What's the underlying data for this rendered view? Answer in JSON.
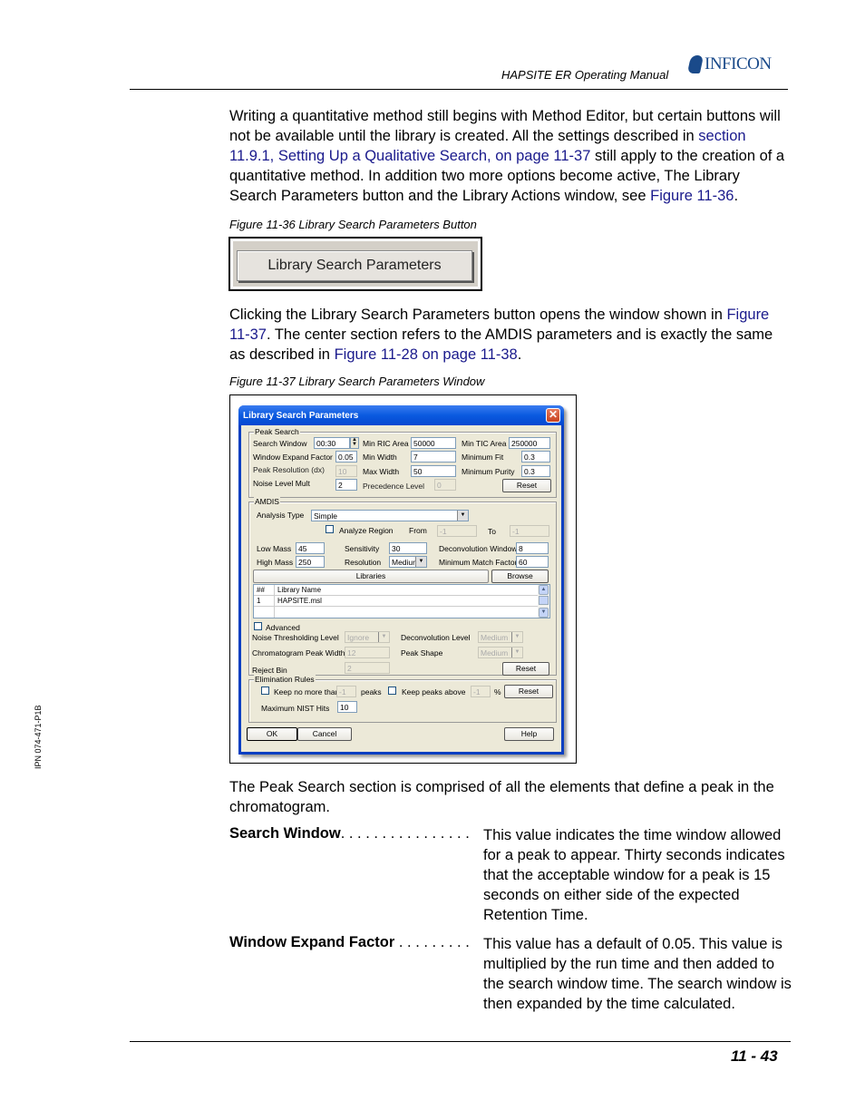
{
  "header": {
    "manual_title": "HAPSITE ER Operating Manual",
    "logo_text": "INFICON"
  },
  "side_code": "IPN 074-471-P1B",
  "intro": {
    "text_1": "Writing a quantitative method still begins with Method Editor, but certain buttons will not be available until the library is created. All the settings described in ",
    "link_1": "section 11.9.1, Setting Up a Qualitative Search, on page 11-37",
    "text_2": " still apply to the creation of a quantitative method. In addition two more options become active, The Library Search Parameters button and the Library Actions window, see ",
    "link_2": "Figure 11-36",
    "text_3": "."
  },
  "figure_36": {
    "caption": "Figure 11-36  Library Search Parameters Button",
    "button_label": "Library Search Parameters"
  },
  "para_2": {
    "text_1": "Clicking the Library Search Parameters button opens the window shown in ",
    "link_1": "Figure 11-37",
    "text_2": ". The center section refers to the AMDIS parameters and is exactly the same as described in ",
    "link_2": "Figure 11-28 on page 11-38",
    "text_3": "."
  },
  "figure_37": {
    "caption": "Figure 11-37  Library Search Parameters Window",
    "dialog": {
      "title": "Library Search Parameters",
      "close_glyph": "✕",
      "peak_search": {
        "group_label": "Peak Search",
        "search_window_label": "Search Window",
        "search_window_value": "00:30",
        "window_expand_factor_label": "Window Expand Factor",
        "window_expand_factor_value": "0.05",
        "peak_resolution_label": "Peak Resolution (dx)",
        "peak_resolution_value": "10",
        "noise_level_mult_label": "Noise Level Mult",
        "noise_level_mult_value": "2",
        "min_ric_area_label": "Min RIC Area",
        "min_ric_area_value": "50000",
        "min_width_label": "Min Width",
        "min_width_value": "7",
        "max_width_label": "Max Width",
        "max_width_value": "50",
        "precedence_level_label": "Precedence Level",
        "precedence_level_value": "0",
        "min_tic_area_label": "Min TIC Area",
        "min_tic_area_value": "250000",
        "minimum_fit_label": "Minimum Fit",
        "minimum_fit_value": "0.3",
        "minimum_purity_label": "Minimum Purity",
        "minimum_purity_value": "0.3",
        "reset_label": "Reset"
      },
      "amdis": {
        "group_label": "AMDIS",
        "analysis_type_label": "Analysis Type",
        "analysis_type_value": "Simple",
        "analyze_region_label": "Analyze Region",
        "from_label": "From",
        "from_value": "-1",
        "to_label": "To",
        "to_value": "-1",
        "low_mass_label": "Low Mass",
        "low_mass_value": "45",
        "high_mass_label": "High Mass",
        "high_mass_value": "250",
        "sensitivity_label": "Sensitivity",
        "sensitivity_value": "30",
        "resolution_label": "Resolution",
        "resolution_value": "Mediur",
        "deconvolution_window_label": "Deconvolution Window",
        "deconvolution_window_value": "8",
        "minimum_match_factor_label": "Minimum Match Factor",
        "minimum_match_factor_value": "60",
        "libraries_label": "Libraries",
        "browse_label": "Browse",
        "library_table": {
          "headers": [
            "##",
            "Library Name"
          ],
          "rows": [
            [
              "1",
              "HAPSITE.msl"
            ]
          ]
        },
        "advanced_label": "Advanced",
        "noise_thresholding_label": "Noise Thresholding Level",
        "noise_thresholding_value": "Ignore",
        "chromatogram_peak_width_label": "Chromatogram Peak Width",
        "chromatogram_peak_width_value": "12",
        "reject_bin_label": "Reject Bin",
        "reject_bin_value": "2",
        "deconvolution_level_label": "Deconvolution Level",
        "deconvolution_level_value": "Medium",
        "peak_shape_label": "Peak Shape",
        "peak_shape_value": "Medium",
        "reset_label": "Reset"
      },
      "elimination_rules": {
        "group_label": "Elimination Rules",
        "keep_no_more_than_label": "Keep no more than",
        "keep_no_more_than_value": "-1",
        "peaks_label": "peaks",
        "keep_peaks_above_label": "Keep peaks above",
        "keep_peaks_above_value": "-1",
        "percent_label": "%",
        "maximum_nist_hits_label": "Maximum NIST Hits",
        "maximum_nist_hits_value": "10",
        "reset_label": "Reset"
      },
      "ok_label": "OK",
      "cancel_label": "Cancel",
      "help_label": "Help"
    }
  },
  "para_3": "The Peak Search section is comprised of all the elements that define a peak in the chromatogram.",
  "definitions": [
    {
      "term": "Search Window",
      "dots": ". . . . . . . . . . . . . . . .",
      "body": "This value indicates the time window allowed for a peak to appear. Thirty seconds indicates that the acceptable window for a peak is 15 seconds on either side of the expected Retention Time."
    },
    {
      "term": "Window Expand Factor",
      "dots": " . . . . . . . . .",
      "body": "This value has a default of 0.05. This value is multiplied by the run time and then added to the search window time. The search window is then expanded by the time calculated."
    }
  ],
  "footer": {
    "page_number": "11 - 43"
  }
}
